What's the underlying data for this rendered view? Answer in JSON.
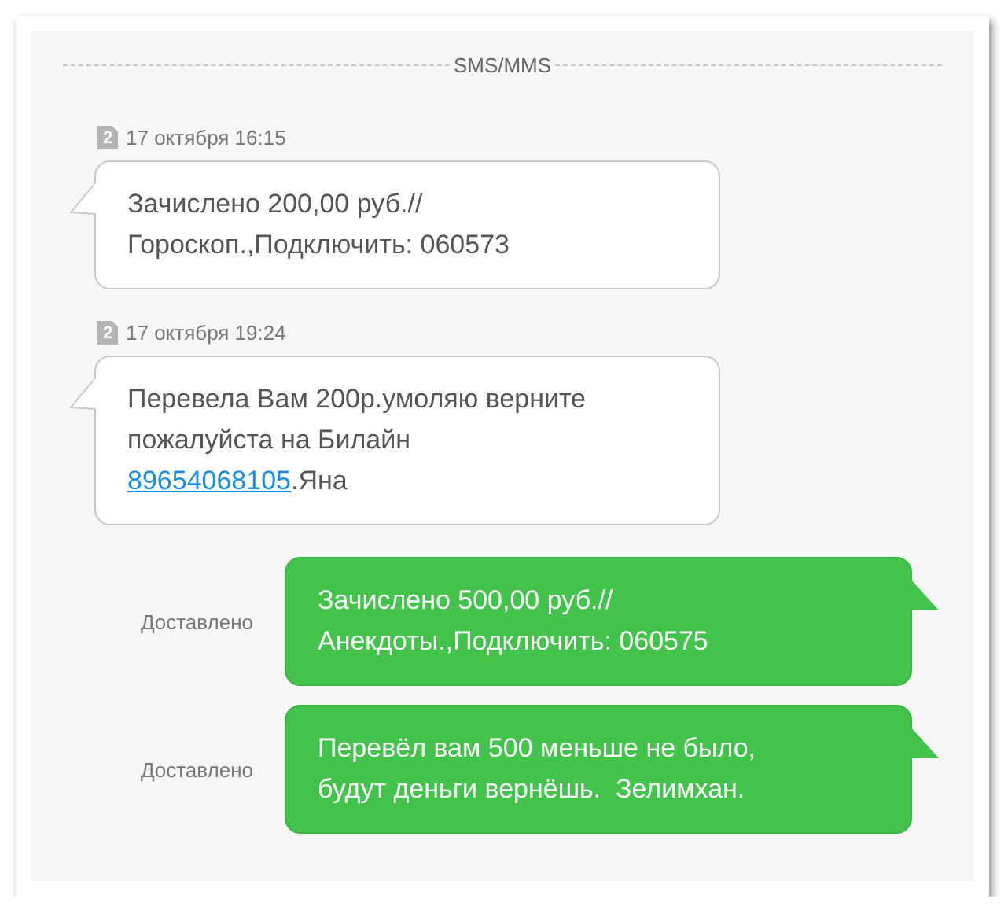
{
  "section_title": "SMS/MMS",
  "messages": [
    {
      "kind": "incoming",
      "sim": "2",
      "time": "17 октября 16:15",
      "parts": [
        {
          "text": "Зачислено 200,00 руб.//\nГороскоп.,Подключить: 060573",
          "link": false
        }
      ]
    },
    {
      "kind": "incoming",
      "sim": "2",
      "time": "17 октября 19:24",
      "parts": [
        {
          "text": "Перевела Вам 200р.умоляю верните\nпожалуйста на Билайн\n",
          "link": false
        },
        {
          "text": "89654068105",
          "link": true
        },
        {
          "text": ".Яна",
          "link": false
        }
      ]
    },
    {
      "kind": "outgoing",
      "status": "Доставлено",
      "parts": [
        {
          "text": "Зачислено 500,00 руб.//\nАнекдоты.,Подключить: 060575",
          "link": false
        }
      ]
    },
    {
      "kind": "outgoing",
      "status": "Доставлено",
      "parts": [
        {
          "text": "Перевёл вам 500 меньше не было,\nбудут деньги вернёшь.  Зелимхан.",
          "link": false
        }
      ]
    }
  ]
}
